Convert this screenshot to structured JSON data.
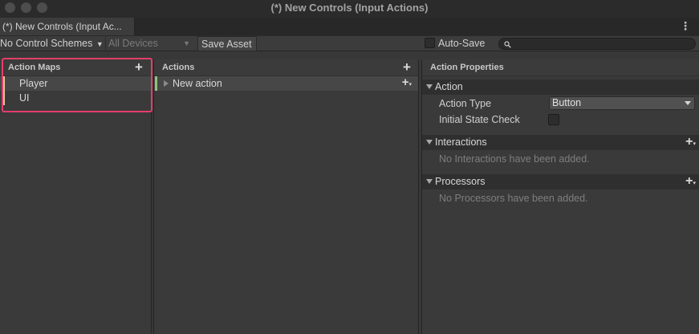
{
  "window": {
    "title": "(*) New Controls (Input Actions)",
    "tab_label": "(*) New Controls (Input Ac...",
    "menu_icon": "vertical-ellipsis-icon"
  },
  "toolbar": {
    "control_schemes": "No Control Schemes",
    "devices": "All Devices",
    "save_asset": "Save Asset",
    "auto_save_label": "Auto-Save",
    "auto_save_checked": false,
    "search_value": ""
  },
  "action_maps": {
    "header": "Action Maps",
    "items": [
      {
        "label": "Player",
        "selected": true
      },
      {
        "label": "UI",
        "selected": false
      }
    ]
  },
  "actions": {
    "header": "Actions",
    "items": [
      {
        "label": "New action",
        "selected": true
      }
    ]
  },
  "properties": {
    "header": "Action Properties",
    "action_section": "Action",
    "action_type_label": "Action Type",
    "action_type_value": "Button",
    "initial_state_label": "Initial State Check",
    "initial_state_checked": false,
    "interactions_section": "Interactions",
    "interactions_empty": "No Interactions have been added.",
    "processors_section": "Processors",
    "processors_empty": "No Processors have been added."
  },
  "colors": {
    "highlight": "#e53d6a",
    "action_map_marker": "#e6c994",
    "action_marker": "#8fc47e"
  }
}
